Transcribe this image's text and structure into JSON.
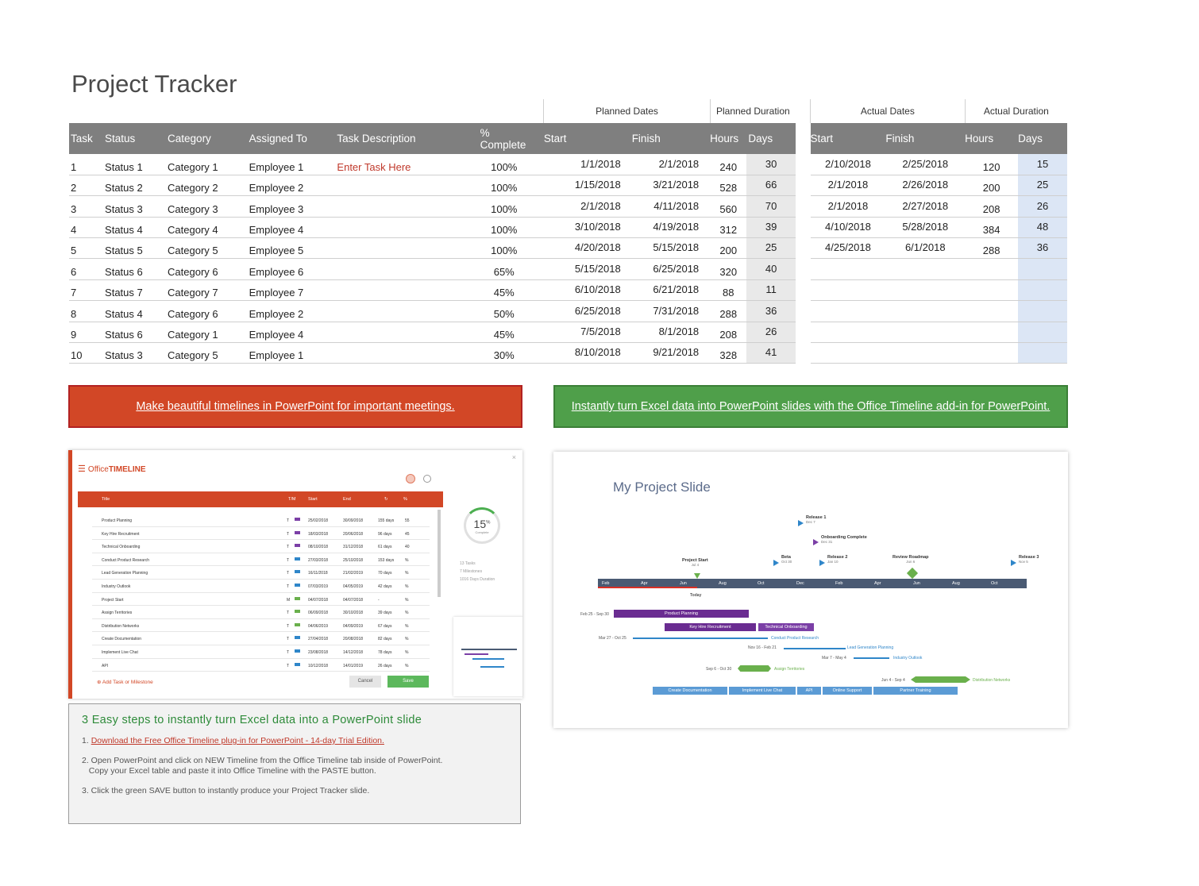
{
  "title": "Project Tracker",
  "planned": {
    "group_dates": "Planned Dates",
    "group_duration": "Planned Duration",
    "headers": [
      "Task",
      "Status",
      "Category",
      "Assigned To",
      "Task Description",
      "% Complete",
      "Start",
      "Finish",
      "Hours",
      "Days"
    ],
    "rows": [
      {
        "task": "1",
        "status": "Status 1",
        "category": "Category 1",
        "assigned": "Employee 1",
        "desc": "Enter Task Here",
        "pct": "100%",
        "start": "1/1/2018",
        "finish": "2/1/2018",
        "hours": "240",
        "days": "30"
      },
      {
        "task": "2",
        "status": "Status 2",
        "category": "Category 2",
        "assigned": "Employee 2",
        "desc": "",
        "pct": "100%",
        "start": "1/15/2018",
        "finish": "3/21/2018",
        "hours": "528",
        "days": "66"
      },
      {
        "task": "3",
        "status": "Status 3",
        "category": "Category 3",
        "assigned": "Employee 3",
        "desc": "",
        "pct": "100%",
        "start": "2/1/2018",
        "finish": "4/11/2018",
        "hours": "560",
        "days": "70"
      },
      {
        "task": "4",
        "status": "Status 4",
        "category": "Category 4",
        "assigned": "Employee 4",
        "desc": "",
        "pct": "100%",
        "start": "3/10/2018",
        "finish": "4/19/2018",
        "hours": "312",
        "days": "39"
      },
      {
        "task": "5",
        "status": "Status 5",
        "category": "Category 5",
        "assigned": "Employee 5",
        "desc": "",
        "pct": "100%",
        "start": "4/20/2018",
        "finish": "5/15/2018",
        "hours": "200",
        "days": "25"
      },
      {
        "task": "6",
        "status": "Status 6",
        "category": "Category 6",
        "assigned": "Employee 6",
        "desc": "",
        "pct": "65%",
        "start": "5/15/2018",
        "finish": "6/25/2018",
        "hours": "320",
        "days": "40"
      },
      {
        "task": "7",
        "status": "Status 7",
        "category": "Category 7",
        "assigned": "Employee 7",
        "desc": "",
        "pct": "45%",
        "start": "6/10/2018",
        "finish": "6/21/2018",
        "hours": "88",
        "days": "11"
      },
      {
        "task": "8",
        "status": "Status 4",
        "category": "Category 6",
        "assigned": "Employee 2",
        "desc": "",
        "pct": "50%",
        "start": "6/25/2018",
        "finish": "7/31/2018",
        "hours": "288",
        "days": "36"
      },
      {
        "task": "9",
        "status": "Status 6",
        "category": "Category 1",
        "assigned": "Employee 4",
        "desc": "",
        "pct": "45%",
        "start": "7/5/2018",
        "finish": "8/1/2018",
        "hours": "208",
        "days": "26"
      },
      {
        "task": "10",
        "status": "Status 3",
        "category": "Category 5",
        "assigned": "Employee 1",
        "desc": "",
        "pct": "30%",
        "start": "8/10/2018",
        "finish": "9/21/2018",
        "hours": "328",
        "days": "41"
      }
    ]
  },
  "actual": {
    "group_dates": "Actual Dates",
    "group_duration": "Actual Duration",
    "headers": [
      "Start",
      "Finish",
      "Hours",
      "Days"
    ],
    "rows": [
      {
        "start": "2/10/2018",
        "finish": "2/25/2018",
        "hours": "120",
        "days": "15"
      },
      {
        "start": "2/1/2018",
        "finish": "2/26/2018",
        "hours": "200",
        "days": "25"
      },
      {
        "start": "2/1/2018",
        "finish": "2/27/2018",
        "hours": "208",
        "days": "26"
      },
      {
        "start": "4/10/2018",
        "finish": "5/28/2018",
        "hours": "384",
        "days": "48"
      },
      {
        "start": "4/25/2018",
        "finish": "6/1/2018",
        "hours": "288",
        "days": "36"
      },
      {
        "start": "",
        "finish": "",
        "hours": "",
        "days": ""
      },
      {
        "start": "",
        "finish": "",
        "hours": "",
        "days": ""
      },
      {
        "start": "",
        "finish": "",
        "hours": "",
        "days": ""
      },
      {
        "start": "",
        "finish": "",
        "hours": "",
        "days": ""
      },
      {
        "start": "",
        "finish": "",
        "hours": "",
        "days": ""
      }
    ]
  },
  "banners": {
    "red": "Make beautiful timelines in PowerPoint for important meetings.",
    "green": "Instantly turn Excel data into PowerPoint slides with the Office Timeline add-in for PowerPoint."
  },
  "office_timeline": {
    "logo_a": "Office",
    "logo_b": "TIMELINE",
    "close": "×",
    "columns": [
      "Title",
      "T/M",
      "Start",
      "End",
      "%"
    ],
    "rows": [
      {
        "title": "Product Planning",
        "tm": "T",
        "start": "25/02/2018",
        "end": "30/09/2018",
        "dur": "155 days",
        "pct": "55",
        "color": "#7b3fa6"
      },
      {
        "title": "Key Hire Recruitment",
        "tm": "T",
        "start": "18/03/2018",
        "end": "20/06/2018",
        "dur": "96 days",
        "pct": "45",
        "color": "#7b3fa6"
      },
      {
        "title": "Technical Onboarding",
        "tm": "T",
        "start": "08/10/2018",
        "end": "31/12/2018",
        "dur": "61 days",
        "pct": "40",
        "color": "#7b3fa6"
      },
      {
        "title": "Conduct Product Research",
        "tm": "T",
        "start": "27/03/2018",
        "end": "25/10/2018",
        "dur": "153 days",
        "pct": "%",
        "color": "#2f86c9"
      },
      {
        "title": "Lead Generation Planning",
        "tm": "T",
        "start": "16/11/2018",
        "end": "21/02/2019",
        "dur": "70 days",
        "pct": "%",
        "color": "#2f86c9"
      },
      {
        "title": "Industry Outlook",
        "tm": "T",
        "start": "07/03/2019",
        "end": "04/05/2019",
        "dur": "42 days",
        "pct": "%",
        "color": "#2f86c9"
      },
      {
        "title": "Project Start",
        "tm": "M",
        "start": "04/07/2018",
        "end": "04/07/2018",
        "dur": "-",
        "pct": "%",
        "color": "#6ab04c"
      },
      {
        "title": "Assign Territories",
        "tm": "T",
        "start": "06/09/2018",
        "end": "30/10/2018",
        "dur": "39 days",
        "pct": "%",
        "color": "#6ab04c"
      },
      {
        "title": "Distribution Networks",
        "tm": "T",
        "start": "04/06/2019",
        "end": "04/09/2019",
        "dur": "67 days",
        "pct": "%",
        "color": "#6ab04c"
      },
      {
        "title": "Create Documentation",
        "tm": "T",
        "start": "27/04/2018",
        "end": "20/08/2018",
        "dur": "82 days",
        "pct": "%",
        "color": "#2f86c9"
      },
      {
        "title": "Implement Live Chat",
        "tm": "T",
        "start": "23/08/2018",
        "end": "14/12/2018",
        "dur": "78 days",
        "pct": "%",
        "color": "#2f86c9"
      },
      {
        "title": "API",
        "tm": "T",
        "start": "10/12/2018",
        "end": "14/01/2019",
        "dur": "26 days",
        "pct": "%",
        "color": "#2f86c9"
      }
    ],
    "pct_value": "15",
    "pct_sup": "%",
    "pct_label": "Complete",
    "stats": [
      "13  Tasks",
      "7  Milestones",
      "1016  Days Duration"
    ],
    "add_task": "⊕  Add Task or Milestone",
    "cancel": "Cancel",
    "save": "Save"
  },
  "steps": {
    "heading": "3 Easy steps to instantly turn Excel data into a PowerPoint slide",
    "step1_prefix": "1. ",
    "step1_link": "Download the Free Office Timeline plug-in for PowerPoint - 14-day Trial Edition.",
    "step2": "2. Open PowerPoint and click on NEW Timeline from the Office Timeline tab inside of PowerPoint.",
    "step2b": "Copy your Excel table and paste it into Office Timeline with the PASTE button.",
    "step3": "3. Click the green SAVE button to instantly produce your Project Tracker slide."
  },
  "slide": {
    "title": "My Project Slide",
    "months": [
      "Feb",
      "Apr",
      "Jun",
      "Aug",
      "Oct",
      "Dec",
      "Feb",
      "Apr",
      "Jun",
      "Aug",
      "Oct"
    ],
    "today": "Today",
    "milestones": [
      {
        "name": "Release 1",
        "date": "Dec 7"
      },
      {
        "name": "Onboarding Complete",
        "date": "Dec 31"
      },
      {
        "name": "Project Start",
        "date": "Jul 4"
      },
      {
        "name": "Beta",
        "date": "Oct 30"
      },
      {
        "name": "Release 2",
        "date": "Jan 10"
      },
      {
        "name": "Review Roadmap",
        "date": "Jun 6"
      },
      {
        "name": "Release 3",
        "date": "Nov 5"
      }
    ],
    "bars": {
      "product_planning": "Product Planning",
      "pp_dates": "Feb 25 - Sep 30",
      "key_hire": "Key Hire Recruitment",
      "tech_onb": "Technical Onboarding",
      "cpr": "Conduct Product Research",
      "cpr_dates": "Mar 27 - Oct 25",
      "lgp": "Lead Generation Planning",
      "lgp_dates": "Nov 16 - Feb 21",
      "io": "Industry Outlook",
      "io_dates": "Mar 7 - May 4",
      "at": "Assign Territories",
      "at_dates": "Sep 6 - Oct 30",
      "dn": "Distribution Networks",
      "dn_dates": "Jun 4 - Sep 4",
      "bottom": [
        "Create Documentation",
        "Implement Live Chat",
        "API",
        "Online Support",
        "Partner Training"
      ]
    }
  }
}
